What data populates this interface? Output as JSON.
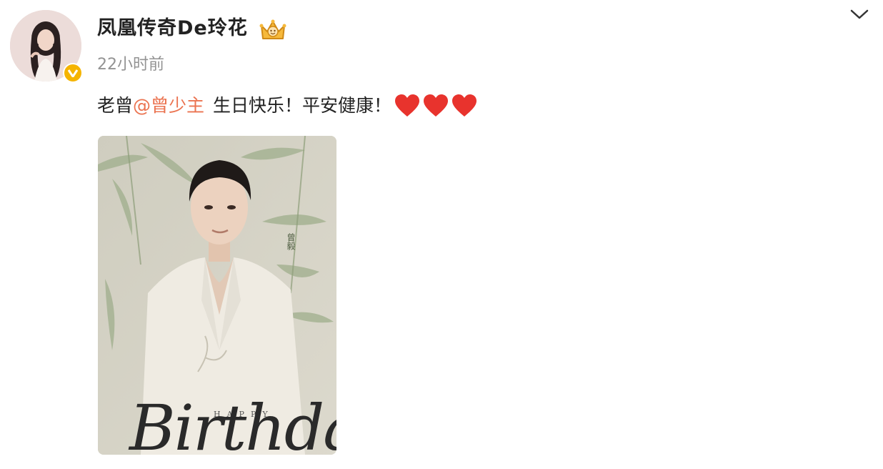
{
  "post": {
    "username": "凤凰传奇De玲花",
    "time": "22小时前",
    "text_prefix": "老曾",
    "mention": "@曾少主",
    "text_suffix": "生日快乐！平安健康！",
    "hearts_count": 3
  },
  "photo": {
    "happy": "HAPPY",
    "birthday": "Birthday",
    "vertical_name": "曾毅"
  },
  "icons": {
    "verified": "verified-badge-icon",
    "crown": "crown-icon",
    "chevron": "chevron-down-icon",
    "heart": "heart-icon"
  },
  "colors": {
    "mention": "#eb7350",
    "verified": "#f5b400",
    "heart": "#e8332d",
    "time": "#939393"
  }
}
